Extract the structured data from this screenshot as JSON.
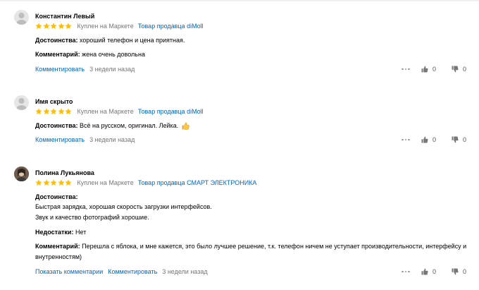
{
  "colors": {
    "link": "#0066cc",
    "star": "#ffbf00",
    "muted": "#777777"
  },
  "reviews": [
    {
      "author": "Константин Левый",
      "rating": 5,
      "bought": "Куплен на Маркете",
      "seller": "Товар продавца diMoll",
      "pros_label": "Достоинства:",
      "pros": "хороший телефон и цена приятная.",
      "comment_label": "Комментарий:",
      "comment": "жена очень довольна",
      "reply_link": "Комментировать",
      "date": "3 недели назад",
      "likes": "0",
      "dislikes": "0"
    },
    {
      "author": "Имя скрыто",
      "rating": 5,
      "bought": "Куплен на Маркете",
      "seller": "Товар продавца diMoll",
      "pros_label": "Достоинства:",
      "pros": "Всё на русском, оригинал. Лейка.",
      "reply_link": "Комментировать",
      "date": "3 недели назад",
      "likes": "0",
      "dislikes": "0"
    },
    {
      "author": "Полина Лукьянова",
      "rating": 5,
      "bought": "Куплен на Маркете",
      "seller": "Товар продавца СМАРТ ЭЛЕКТРОНИКА",
      "pros_label": "Достоинства:",
      "pros_line1": "Быстрая зарядка, хорошая скорость загрузки интерфейсов.",
      "pros_line2": "Звук и качество фотографий хорошие.",
      "cons_label": "Недостатки:",
      "cons": "Нет",
      "comment_label": "Комментарий:",
      "comment_line1": "Перешла с яблока, и мне кажется, это было лучшее решение, т.к. телефон ничем не уступает производительности, интерфейсу и",
      "comment_line2": "внутренностям)",
      "show_comments_link": "Показать комментарии",
      "reply_link": "Комментировать",
      "date": "3 недели назад",
      "likes": "0",
      "dislikes": "0"
    }
  ]
}
